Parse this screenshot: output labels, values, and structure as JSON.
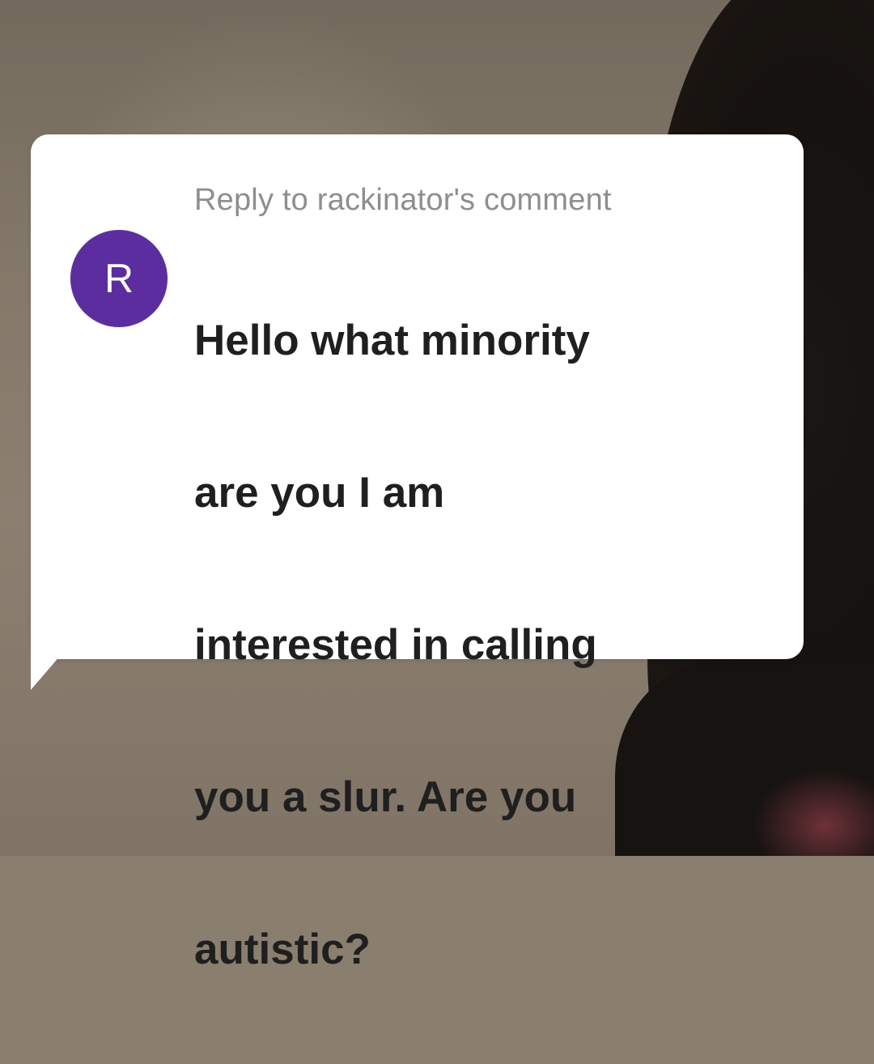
{
  "reply_header": "Reply to rackinator's comment",
  "avatar": {
    "initial": "R",
    "color": "#5c2d9e"
  },
  "comment": {
    "lines": [
      "Hello what minority",
      "are you I am",
      "interested in calling",
      "you a slur. Are you",
      "autistic?"
    ]
  },
  "colors": {
    "bubble": "#ffffff",
    "reply_text": "#8e8e8e",
    "comment_text": "#1f1f1f"
  }
}
